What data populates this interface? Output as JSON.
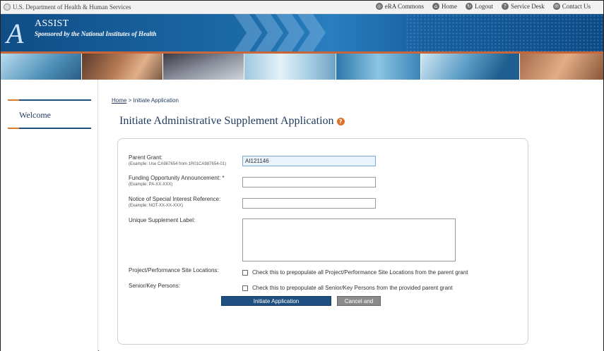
{
  "topbar": {
    "hhs_label": "U.S. Department of Health & Human Services",
    "links": [
      {
        "label": "eRA Commons",
        "icon": "globe-icon"
      },
      {
        "label": "Home",
        "icon": "home-icon"
      },
      {
        "label": "Logout",
        "icon": "logout-icon"
      },
      {
        "label": "Service Desk",
        "icon": "help-icon"
      },
      {
        "label": "Contact Us",
        "icon": "contact-icon"
      }
    ]
  },
  "header": {
    "title": "ASSIST",
    "subtitle": "Sponsored by the National Institutes of Health",
    "logo_letter": "A"
  },
  "colors": {
    "brand_blue": "#1d4f80",
    "accent_orange": "#d97b2e",
    "banner_blue": "#1b6aa8"
  },
  "sidebar": {
    "welcome": "Welcome"
  },
  "breadcrumb": {
    "home": "Home",
    "separator": ">",
    "current": "Initiate Application"
  },
  "page": {
    "title": "Initiate Administrative Supplement Application"
  },
  "form": {
    "parent_grant": {
      "label": "Parent Grant:",
      "example": "(Example: Use CA987654 from 1R01CA987654-01)",
      "value": "AI121146"
    },
    "foa": {
      "label": "Funding Opportunity Announcement: *",
      "example": "(Example: PA-XX-XXX)",
      "value": ""
    },
    "nosi": {
      "label": "Notice of Special Interest Reference:",
      "example": "(Example: NOT-XX-XX-XXX)",
      "value": ""
    },
    "supplement_label": {
      "label": "Unique Supplement Label:",
      "value": ""
    },
    "site_locations": {
      "label": "Project/Performance Site Locations:",
      "checkbox_text": "Check this to prepopulate all Project/Performance Site Locations from the parent grant"
    },
    "key_persons": {
      "label": "Senior/Key Persons:",
      "checkbox_text": "Check this to prepopulate all Senior/Key Persons from the provided parent grant"
    },
    "initiate_button": "Initiate Application",
    "cancel_button": "Cancel and Clear"
  }
}
